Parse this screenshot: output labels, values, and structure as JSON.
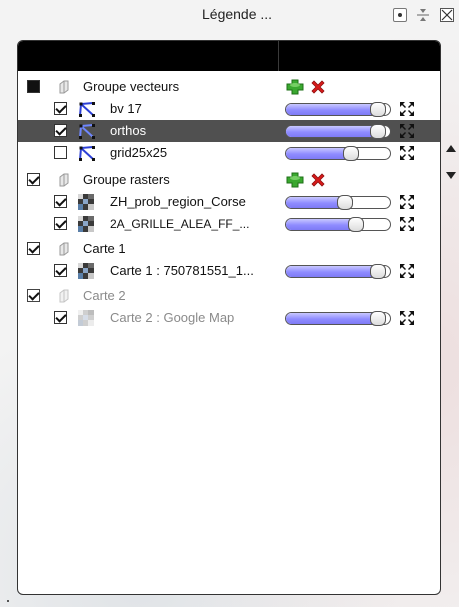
{
  "window": {
    "title": "Légende ...",
    "buttons": [
      {
        "name": "pin",
        "icon": "pin-icon"
      },
      {
        "name": "float",
        "icon": "float-icon"
      },
      {
        "name": "close",
        "icon": "close-icon"
      }
    ]
  },
  "legend": {
    "rows": [
      {
        "label": "Groupe vecteurs",
        "type": "group",
        "check": "filled",
        "actions": [
          "add-icon",
          "remove-icon"
        ]
      },
      {
        "label": "bv 17",
        "type": "vector",
        "check": "checked",
        "opacity": 0.96
      },
      {
        "label": "orthos",
        "type": "vector",
        "check": "checked",
        "opacity": 0.96,
        "selected": true
      },
      {
        "label": "grid25x25",
        "type": "vector",
        "check": "unchecked",
        "opacity": 0.65
      },
      {
        "label": "Groupe rasters",
        "type": "group",
        "check": "checked",
        "actions": [
          "add-icon",
          "remove-icon"
        ]
      },
      {
        "label": "ZH_prob_region_Corse",
        "type": "raster",
        "check": "checked",
        "opacity": 0.6
      },
      {
        "label": "2A_GRILLE_ALEA_FF_...",
        "type": "raster",
        "check": "checked",
        "opacity": 0.7
      },
      {
        "label": "Carte 1",
        "type": "group",
        "check": "checked"
      },
      {
        "label": "Carte 1 : 750781551_1...",
        "type": "raster",
        "check": "checked",
        "opacity": 0.96
      },
      {
        "label": "Carte 2",
        "type": "group",
        "check": "checked",
        "dim": true
      },
      {
        "label": "Carte 2 : Google Map",
        "type": "raster",
        "check": "checked",
        "opacity": 0.96,
        "dim": true
      }
    ]
  },
  "colors": {
    "header": "#000000",
    "selected_row": "#505050",
    "slider_fill": "#8f8cff",
    "add_icon": "#3aa82f",
    "remove_icon": "#d81b1b"
  }
}
